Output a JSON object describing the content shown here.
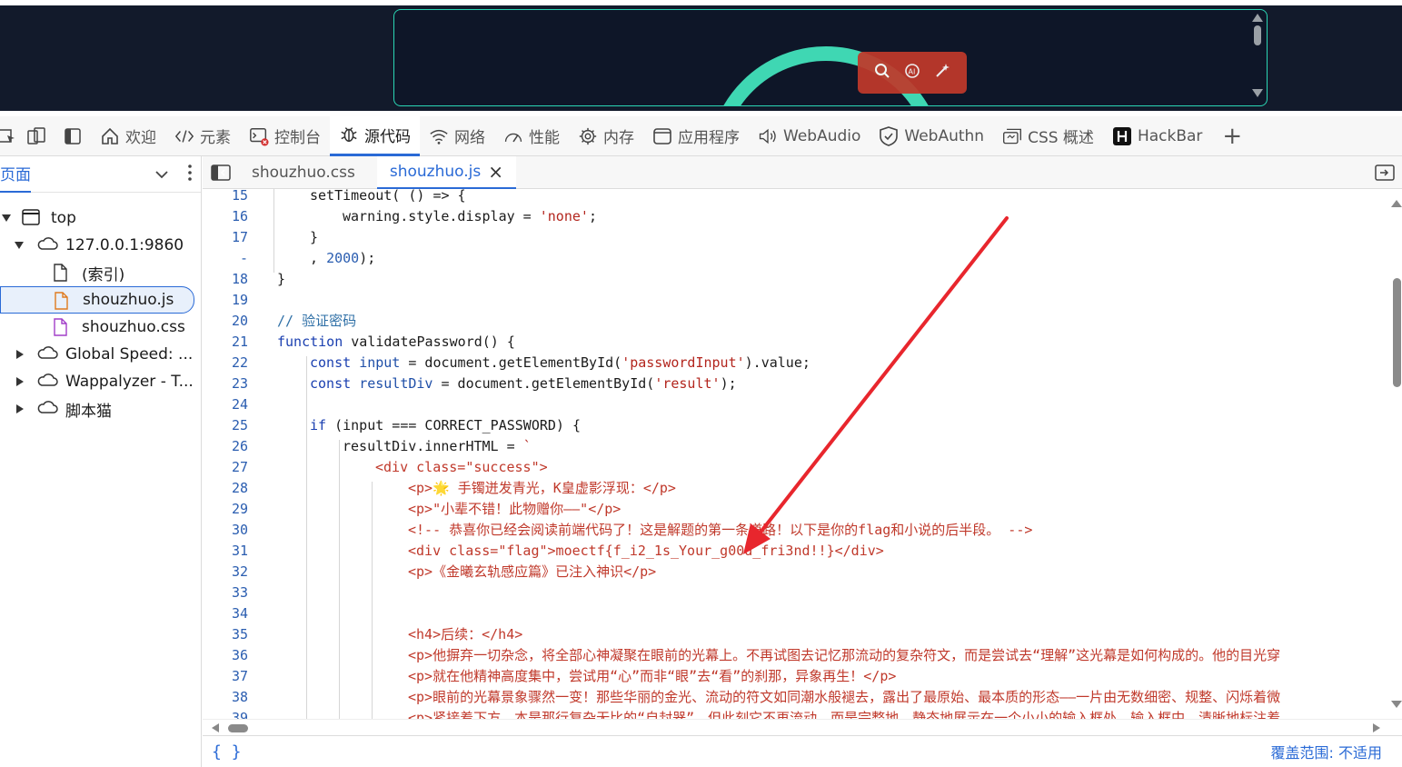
{
  "devtools": {
    "tabs": [
      {
        "label": "欢迎",
        "icon": "home-icon"
      },
      {
        "label": "元素",
        "icon": "code-tag-icon"
      },
      {
        "label": "控制台",
        "icon": "console-icon"
      },
      {
        "label": "源代码",
        "icon": "bug-icon",
        "active": true
      },
      {
        "label": "网络",
        "icon": "wifi-icon"
      },
      {
        "label": "性能",
        "icon": "gauge-icon"
      },
      {
        "label": "内存",
        "icon": "chip-icon"
      },
      {
        "label": "应用程序",
        "icon": "app-window-icon"
      },
      {
        "label": "WebAudio",
        "icon": "speaker-icon"
      },
      {
        "label": "WebAuthn",
        "icon": "shield-icon"
      },
      {
        "label": "CSS 概述",
        "icon": "css-overview-icon"
      },
      {
        "label": "HackBar",
        "icon": "hackbar-icon"
      }
    ],
    "add_tab": "+"
  },
  "left_panel": {
    "title": "页面",
    "tree": [
      {
        "label": "top",
        "icon": "frame-icon"
      },
      {
        "label": "127.0.0.1:9860",
        "icon": "cloud-icon"
      },
      {
        "label": "(索引)",
        "icon": "file-icon"
      },
      {
        "label": "shouzhuo.js",
        "icon": "js-file-icon",
        "selected": true
      },
      {
        "label": "shouzhuo.css",
        "icon": "css-file-icon"
      },
      {
        "label": "Global Speed: ...",
        "icon": "cloud-icon"
      },
      {
        "label": "Wappalyzer - T...",
        "icon": "cloud-icon"
      },
      {
        "label": "脚本猫",
        "icon": "cloud-icon"
      }
    ]
  },
  "editor": {
    "file_tabs": [
      {
        "label": "shouzhuo.css",
        "active": false
      },
      {
        "label": "shouzhuo.js",
        "active": true
      }
    ],
    "close_glyph": "×",
    "lines": [
      {
        "n": "15",
        "indent": 1,
        "parts": [
          [
            "t",
            "setTimeout( () => {"
          ]
        ]
      },
      {
        "n": "16",
        "indent": 2,
        "parts": [
          [
            "t",
            "warning.style.display = "
          ],
          [
            "s",
            "'none'"
          ],
          [
            "t",
            ";"
          ]
        ]
      },
      {
        "n": "17",
        "indent": 1,
        "parts": [
          [
            "t",
            "}"
          ]
        ]
      },
      {
        "n": "-",
        "indent": 1,
        "parts": [
          [
            "t",
            ", "
          ],
          [
            "n",
            "2000"
          ],
          [
            "t",
            ");"
          ]
        ]
      },
      {
        "n": "18",
        "indent": 0,
        "parts": [
          [
            "t",
            "}"
          ]
        ]
      },
      {
        "n": "19",
        "indent": 0,
        "parts": []
      },
      {
        "n": "20",
        "indent": 0,
        "parts": [
          [
            "c",
            "// 验证密码"
          ]
        ]
      },
      {
        "n": "21",
        "indent": 0,
        "parts": [
          [
            "k",
            "function"
          ],
          [
            "t",
            " validatePassword() {"
          ]
        ]
      },
      {
        "n": "22",
        "indent": 1,
        "parts": [
          [
            "k",
            "const"
          ],
          [
            "t",
            " "
          ],
          [
            "v",
            "input"
          ],
          [
            "t",
            " = document.getElementById("
          ],
          [
            "s",
            "'passwordInput'"
          ],
          [
            "t",
            ").value;"
          ]
        ]
      },
      {
        "n": "23",
        "indent": 1,
        "parts": [
          [
            "k",
            "const"
          ],
          [
            "t",
            " "
          ],
          [
            "v",
            "resultDiv"
          ],
          [
            "t",
            " = document.getElementById("
          ],
          [
            "s",
            "'result'"
          ],
          [
            "t",
            ");"
          ]
        ]
      },
      {
        "n": "24",
        "indent": 0,
        "parts": []
      },
      {
        "n": "25",
        "indent": 1,
        "parts": [
          [
            "k",
            "if"
          ],
          [
            "t",
            " (input === CORRECT_PASSWORD) {"
          ]
        ]
      },
      {
        "n": "26",
        "indent": 2,
        "parts": [
          [
            "t",
            "resultDiv.innerHTML = "
          ],
          [
            "s",
            "`"
          ]
        ]
      },
      {
        "n": "27",
        "indent": 3,
        "parts": [
          [
            "h",
            "<div class=\"success\">"
          ]
        ]
      },
      {
        "n": "28",
        "indent": 4,
        "parts": [
          [
            "h",
            "<p>🌟 手镯迸发青光，K皇虚影浮现：</p>"
          ]
        ]
      },
      {
        "n": "29",
        "indent": 4,
        "parts": [
          [
            "h",
            "<p>\"小辈不错！此物赠你——\"</p>"
          ]
        ]
      },
      {
        "n": "30",
        "indent": 4,
        "parts": [
          [
            "h",
            "<!-- 恭喜你已经会阅读前端代码了！这是解题的第一条道路！以下是你的flag和小说的后半段。 -->"
          ]
        ]
      },
      {
        "n": "31",
        "indent": 4,
        "parts": [
          [
            "h",
            "<div class=\"flag\">moectf{f_i2_1s_Your_g00d_fri3nd!!}</div>"
          ]
        ]
      },
      {
        "n": "32",
        "indent": 4,
        "parts": [
          [
            "h",
            "<p>《金曦玄轨感应篇》已注入神识</p>"
          ]
        ]
      },
      {
        "n": "33",
        "indent": 0,
        "parts": []
      },
      {
        "n": "34",
        "indent": 0,
        "parts": []
      },
      {
        "n": "35",
        "indent": 4,
        "parts": [
          [
            "h",
            "<h4>后续：</h4>"
          ]
        ]
      },
      {
        "n": "36",
        "indent": 4,
        "parts": [
          [
            "h",
            "<p>他摒弃一切杂念，将全部心神凝聚在眼前的光幕上。不再试图去记忆那流动的复杂符文，而是尝试去“理解”这光幕是如何构成的。他的目光穿"
          ]
        ]
      },
      {
        "n": "37",
        "indent": 4,
        "parts": [
          [
            "h",
            "<p>就在他精神高度集中，尝试用“心”而非“眼”去“看”的刹那，异象再生！</p>"
          ]
        ]
      },
      {
        "n": "38",
        "indent": 4,
        "parts": [
          [
            "h",
            "<p>眼前的光幕景象骤然一变！那些华丽的金光、流动的符文如同潮水般褪去，露出了最原始、最本质的形态——一片由无数细密、规整、闪烁着微"
          ]
        ]
      },
      {
        "n": "39",
        "indent": 4,
        "parts": [
          [
            "h",
            "<p>紧接着下方，本是那行复杂无比的“自封器”，但此刻它不再流动，而是完整地、静态地展示在一个小小的输入框处。输入框中，清晰地标注着"
          ]
        ]
      }
    ]
  },
  "status": {
    "brackets": "{ }",
    "coverage": "覆盖范围: 不适用"
  },
  "colors": {
    "accent": "#2a6ad6",
    "annotation_arrow": "#e8262d"
  }
}
